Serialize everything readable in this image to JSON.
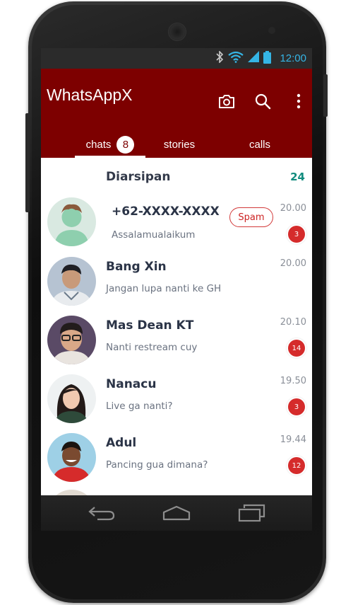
{
  "status_bar": {
    "time": "12:00",
    "icons": [
      "bluetooth-icon",
      "wifi-icon",
      "signal-icon",
      "battery-icon"
    ]
  },
  "app": {
    "title": "WhatsAppX",
    "bar_color": "#7d0000",
    "accent": "#128c7e"
  },
  "actions": [
    "camera-icon",
    "search-icon",
    "more-vert-icon"
  ],
  "tabs": [
    {
      "label": "chats",
      "badge": "8",
      "active": true
    },
    {
      "label": "stories"
    },
    {
      "label": "calls"
    }
  ],
  "archived": {
    "label": "Diarsipan",
    "count": "24"
  },
  "chats": [
    {
      "name": "+62-XXXX-XXXX",
      "message": "Assalamualaikum",
      "time": "20.00",
      "unread": "3",
      "tag": "Spam"
    },
    {
      "name": "Bang Xin",
      "message": "Jangan lupa nanti ke GH",
      "time": "20.00"
    },
    {
      "name": "Mas Dean KT",
      "message": "Nanti restream cuy",
      "time": "20.10",
      "unread": "14"
    },
    {
      "name": "Nanacu",
      "message": "Live ga nanti?",
      "time": "19.50",
      "unread": "3"
    },
    {
      "name": "Adul",
      "message": "Pancing gua dimana?",
      "time": "19.44",
      "unread": "12"
    }
  ],
  "nav_buttons": [
    "back-icon",
    "home-icon",
    "recents-icon"
  ]
}
